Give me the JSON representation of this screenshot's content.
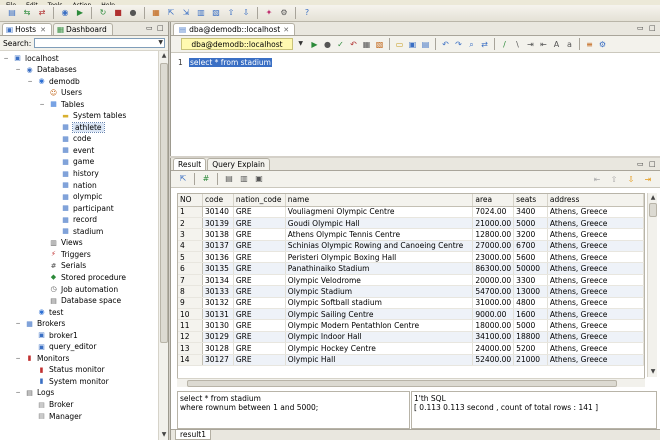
{
  "menu": [
    "File",
    "Edit",
    "Tools",
    "Action",
    "Help"
  ],
  "toolbar": {
    "icons": [
      "new-window-icon",
      "connect-icon",
      "disconnect-icon",
      "database-icon",
      "run-icon",
      "refresh-icon",
      "stop-icon",
      "start-icon",
      "query-editor-icon",
      "export-icon",
      "import-icon",
      "backup-icon",
      "restore-icon",
      "unload-icon",
      "load-icon",
      "plugin-icon",
      "options-icon",
      "help-icon"
    ]
  },
  "left": {
    "tabs": [
      {
        "label": "Hosts"
      },
      {
        "label": "Dashboard"
      }
    ],
    "search_label": "Search:",
    "tree": [
      {
        "label": "localhost",
        "depth": 0,
        "icon": "host-icon",
        "expanded": true
      },
      {
        "label": "Databases",
        "depth": 1,
        "icon": "databases-icon",
        "expanded": true
      },
      {
        "label": "demodb",
        "depth": 2,
        "icon": "database-icon",
        "expanded": true
      },
      {
        "label": "Users",
        "depth": 3,
        "icon": "users-icon"
      },
      {
        "label": "Tables",
        "depth": 3,
        "icon": "tables-icon",
        "expanded": true
      },
      {
        "label": "System tables",
        "depth": 4,
        "icon": "folder-icon"
      },
      {
        "label": "athlete",
        "depth": 4,
        "icon": "table-icon",
        "selected": true
      },
      {
        "label": "code",
        "depth": 4,
        "icon": "table-icon"
      },
      {
        "label": "event",
        "depth": 4,
        "icon": "table-icon"
      },
      {
        "label": "game",
        "depth": 4,
        "icon": "table-icon"
      },
      {
        "label": "history",
        "depth": 4,
        "icon": "table-icon"
      },
      {
        "label": "nation",
        "depth": 4,
        "icon": "table-icon"
      },
      {
        "label": "olympic",
        "depth": 4,
        "icon": "table-icon"
      },
      {
        "label": "participant",
        "depth": 4,
        "icon": "table-icon"
      },
      {
        "label": "record",
        "depth": 4,
        "icon": "table-icon"
      },
      {
        "label": "stadium",
        "depth": 4,
        "icon": "table-icon"
      },
      {
        "label": "Views",
        "depth": 3,
        "icon": "views-icon"
      },
      {
        "label": "Triggers",
        "depth": 3,
        "icon": "triggers-icon"
      },
      {
        "label": "Serials",
        "depth": 3,
        "icon": "serials-icon"
      },
      {
        "label": "Stored procedure",
        "depth": 3,
        "icon": "procedure-icon"
      },
      {
        "label": "Job automation",
        "depth": 3,
        "icon": "job-icon"
      },
      {
        "label": "Database space",
        "depth": 3,
        "icon": "space-icon"
      },
      {
        "label": "test",
        "depth": 2,
        "icon": "database-icon"
      },
      {
        "label": "Brokers",
        "depth": 1,
        "icon": "brokers-icon",
        "expanded": true
      },
      {
        "label": "broker1",
        "depth": 2,
        "icon": "broker-icon"
      },
      {
        "label": "query_editor",
        "depth": 2,
        "icon": "broker-icon"
      },
      {
        "label": "Monitors",
        "depth": 1,
        "icon": "monitors-icon",
        "expanded": true
      },
      {
        "label": "Status monitor",
        "depth": 2,
        "icon": "status-monitor-icon"
      },
      {
        "label": "System monitor",
        "depth": 2,
        "icon": "system-monitor-icon"
      },
      {
        "label": "Logs",
        "depth": 1,
        "icon": "logs-icon",
        "expanded": true
      },
      {
        "label": "Broker",
        "depth": 2,
        "icon": "log-icon"
      },
      {
        "label": "Manager",
        "depth": 2,
        "icon": "log-icon"
      }
    ]
  },
  "editor": {
    "tab_label": "dba@demodb::localhost",
    "connection": "dba@demodb::localhost",
    "line_number": "1",
    "sql": "select * from stadium"
  },
  "result": {
    "tabs": [
      {
        "label": "Result"
      },
      {
        "label": "Query Explain"
      }
    ],
    "columns": [
      "NO",
      "code",
      "nation_code",
      "name",
      "area",
      "seats",
      "address"
    ],
    "rows": [
      [
        "1",
        "30140",
        "GRE",
        "Vouliagmeni Olympic Centre",
        "7024.00",
        "3400",
        "Athens, Greece"
      ],
      [
        "2",
        "30139",
        "GRE",
        "Goudi Olympic Hall",
        "21000.00",
        "5000",
        "Athens, Greece"
      ],
      [
        "3",
        "30138",
        "GRE",
        "Athens Olympic Tennis Centre",
        "12800.00",
        "3200",
        "Athens, Greece"
      ],
      [
        "4",
        "30137",
        "GRE",
        "Schinias Olympic Rowing and Canoeing Centre",
        "27000.00",
        "6700",
        "Athens, Greece"
      ],
      [
        "5",
        "30136",
        "GRE",
        "Peristeri Olympic Boxing Hall",
        "23000.00",
        "5600",
        "Athens, Greece"
      ],
      [
        "6",
        "30135",
        "GRE",
        "Panathinaiko Stadium",
        "86300.00",
        "50000",
        "Athens, Greece"
      ],
      [
        "7",
        "30134",
        "GRE",
        "Olympic Velodrome",
        "20000.00",
        "3300",
        "Athens, Greece"
      ],
      [
        "8",
        "30133",
        "GRE",
        "Olympic Stadium",
        "54700.00",
        "13000",
        "Athens, Greece"
      ],
      [
        "9",
        "30132",
        "GRE",
        "Olympic Softball stadium",
        "31000.00",
        "4800",
        "Athens, Greece"
      ],
      [
        "10",
        "30131",
        "GRE",
        "Olympic Sailing Centre",
        "9000.00",
        "1600",
        "Athens, Greece"
      ],
      [
        "11",
        "30130",
        "GRE",
        "Olympic Modern Pentathlon Centre",
        "18000.00",
        "5000",
        "Athens, Greece"
      ],
      [
        "12",
        "30129",
        "GRE",
        "Olympic Indoor Hall",
        "34100.00",
        "18800",
        "Athens, Greece"
      ],
      [
        "13",
        "30128",
        "GRE",
        "Olympic Hockey Centre",
        "24000.00",
        "5200",
        "Athens, Greece"
      ],
      [
        "14",
        "30127",
        "GRE",
        "Olympic Hall",
        "52400.00",
        "21000",
        "Athens, Greece"
      ]
    ],
    "sql_text_1": "select * from stadium",
    "sql_text_2": "where rownum between 1 and 5000;",
    "msg_1": "1'th SQL",
    "msg_2": "[ 0.113 0.113 second , count of total rows : 141 ]",
    "bottom_tab": "result1"
  }
}
